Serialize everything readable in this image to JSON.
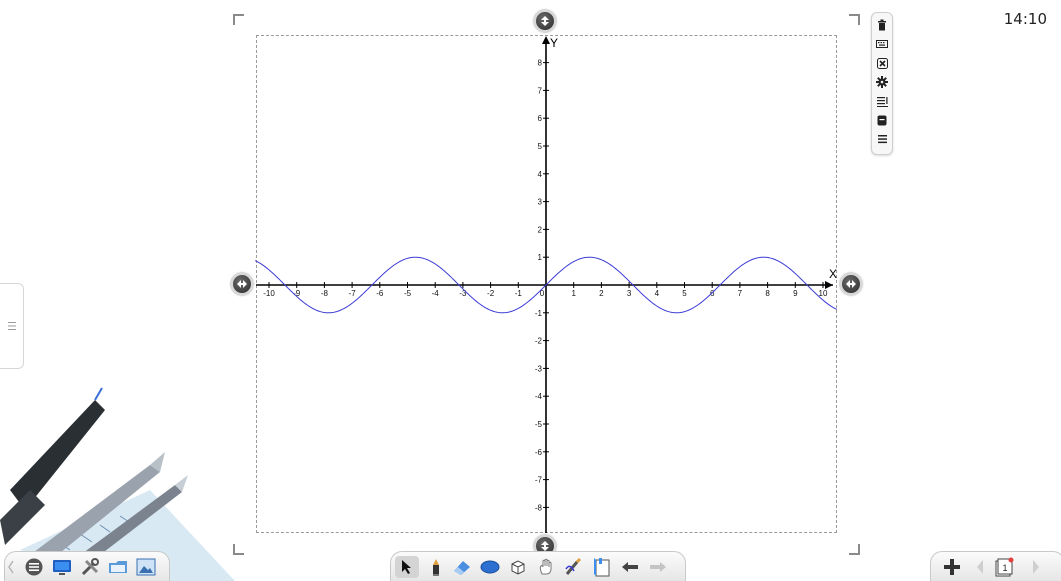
{
  "clock": {
    "time": "14:10"
  },
  "graph": {
    "x_axis_label": "X",
    "y_axis_label": "Y",
    "x_ticks": [
      "-10",
      "-9",
      "-8",
      "-7",
      "-6",
      "-5",
      "-4",
      "-3",
      "-2",
      "-1",
      "0",
      "1",
      "2",
      "3",
      "4",
      "5",
      "6",
      "7",
      "8",
      "9",
      "10"
    ],
    "y_ticks": [
      "8",
      "7",
      "6",
      "5",
      "4",
      "3",
      "2",
      "1",
      "-1",
      "-2",
      "-3",
      "-4",
      "-5",
      "-6",
      "-7",
      "-8"
    ],
    "curve_color": "#3b3bd6"
  },
  "chart_data": {
    "type": "line",
    "function": "y = sin(x)",
    "xlim": [
      -10.5,
      10.5
    ],
    "ylim": [
      -9,
      9
    ],
    "xlabel": "X",
    "ylabel": "Y",
    "grid": false
  },
  "right_toolbar": {
    "items": [
      "trash-icon",
      "keyboard-icon",
      "close-box-icon",
      "gear-icon",
      "text-list-icon",
      "page-icon",
      "menu-icon"
    ]
  },
  "bottom_left_toolbar": {
    "items": [
      "chevron-left-icon",
      "menu-icon",
      "monitor-icon",
      "tools-icon",
      "folder-icon",
      "image-icon"
    ]
  },
  "bottom_center_toolbar": {
    "items": [
      "pointer-icon",
      "pen-icon",
      "eraser-icon",
      "ellipse-icon",
      "cube-icon",
      "hand-icon",
      "magic-pen-icon",
      "page-flip-icon",
      "undo-icon",
      "redo-icon"
    ]
  },
  "bottom_right_toolbar": {
    "items": [
      "add-page-icon",
      "prev-page-icon",
      "page-number-icon",
      "next-page-icon"
    ]
  }
}
